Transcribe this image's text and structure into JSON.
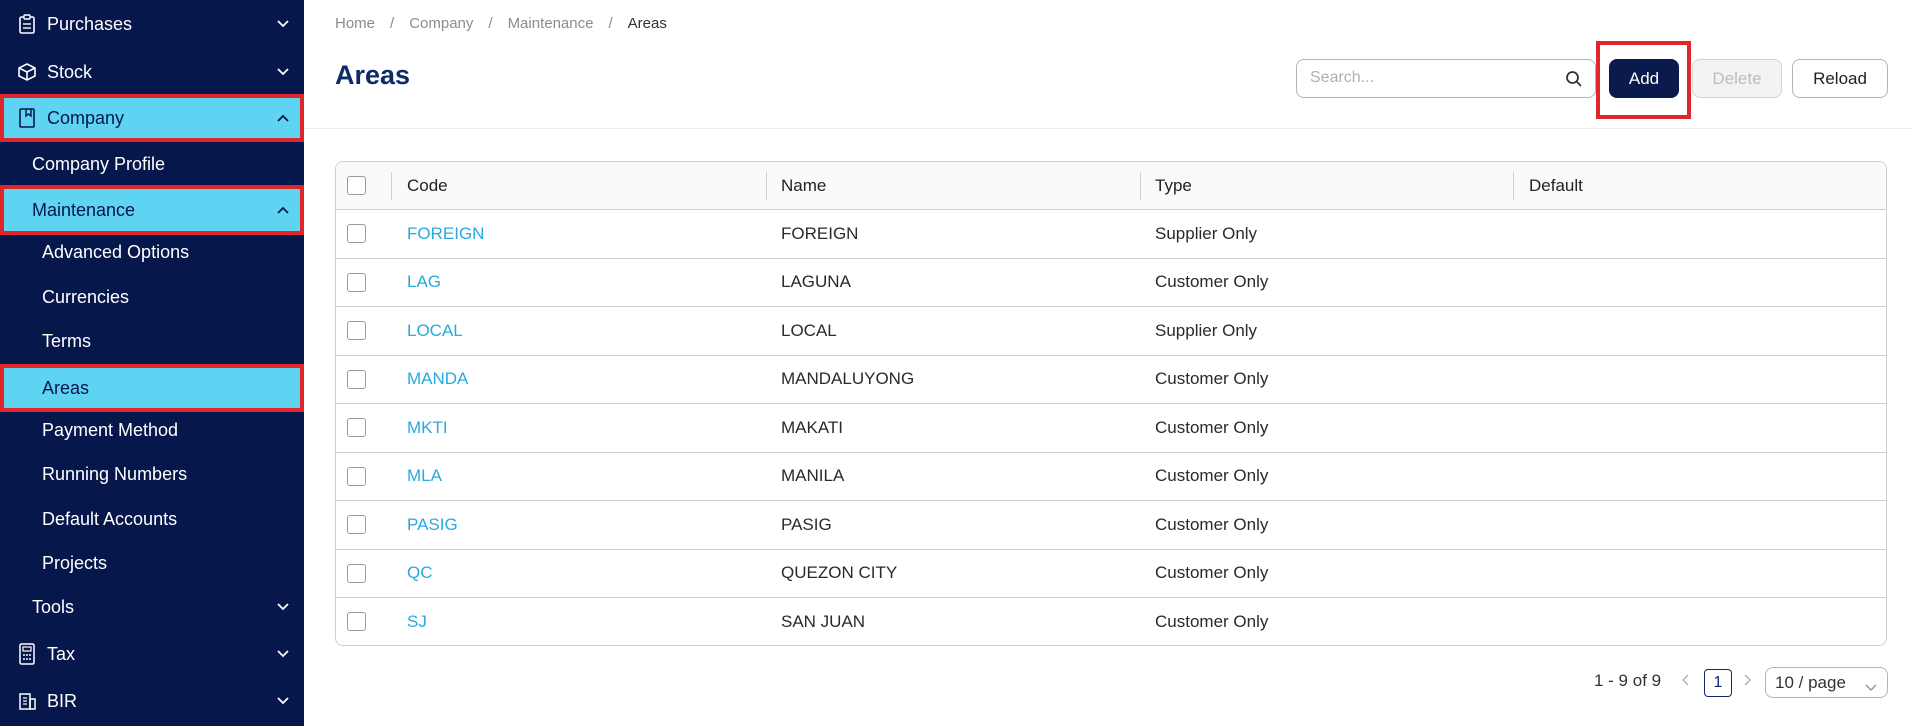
{
  "sidebar": {
    "items": [
      {
        "label": "Purchases",
        "icon": "clipboard-icon",
        "chevron": "down"
      },
      {
        "label": "Stock",
        "icon": "box-icon",
        "chevron": "down"
      },
      {
        "label": "Company",
        "icon": "book-icon",
        "chevron": "up",
        "active": true
      },
      {
        "label": "Company Profile"
      },
      {
        "label": "Maintenance",
        "chevron": "up",
        "active": true
      },
      {
        "label": "Advanced Options"
      },
      {
        "label": "Currencies"
      },
      {
        "label": "Terms"
      },
      {
        "label": "Areas",
        "active": true
      },
      {
        "label": "Payment Method"
      },
      {
        "label": "Running Numbers"
      },
      {
        "label": "Default Accounts"
      },
      {
        "label": "Projects"
      },
      {
        "label": "Tools",
        "chevron": "down"
      },
      {
        "label": "Tax",
        "icon": "calculator-icon",
        "chevron": "down"
      },
      {
        "label": "BIR",
        "icon": "building-icon",
        "chevron": "down"
      }
    ]
  },
  "breadcrumb": [
    "Home",
    "Company",
    "Maintenance",
    "Areas"
  ],
  "page": {
    "title": "Areas"
  },
  "search": {
    "placeholder": "Search..."
  },
  "toolbar": {
    "add_label": "Add",
    "delete_label": "Delete",
    "reload_label": "Reload"
  },
  "table": {
    "columns": [
      "Code",
      "Name",
      "Type",
      "Default"
    ],
    "rows": [
      {
        "code": "FOREIGN",
        "name": "FOREIGN",
        "type": "Supplier Only",
        "default": ""
      },
      {
        "code": "LAG",
        "name": "LAGUNA",
        "type": "Customer Only",
        "default": ""
      },
      {
        "code": "LOCAL",
        "name": "LOCAL",
        "type": "Supplier Only",
        "default": ""
      },
      {
        "code": "MANDA",
        "name": "MANDALUYONG",
        "type": "Customer Only",
        "default": ""
      },
      {
        "code": "MKTI",
        "name": "MAKATI",
        "type": "Customer Only",
        "default": ""
      },
      {
        "code": "MLA",
        "name": "MANILA",
        "type": "Customer Only",
        "default": ""
      },
      {
        "code": "PASIG",
        "name": "PASIG",
        "type": "Customer Only",
        "default": ""
      },
      {
        "code": "QC",
        "name": "QUEZON CITY",
        "type": "Customer Only",
        "default": ""
      },
      {
        "code": "SJ",
        "name": "SAN JUAN",
        "type": "Customer Only",
        "default": ""
      }
    ]
  },
  "pagination": {
    "summary": "1 - 9 of 9",
    "current_page": "1",
    "page_size": "10 / page"
  },
  "colors": {
    "sidebar_bg": "#06174b",
    "active_bg": "#5fd3f2",
    "highlight": "#e0262b",
    "link": "#27a9e1",
    "title": "#0f2a66"
  }
}
